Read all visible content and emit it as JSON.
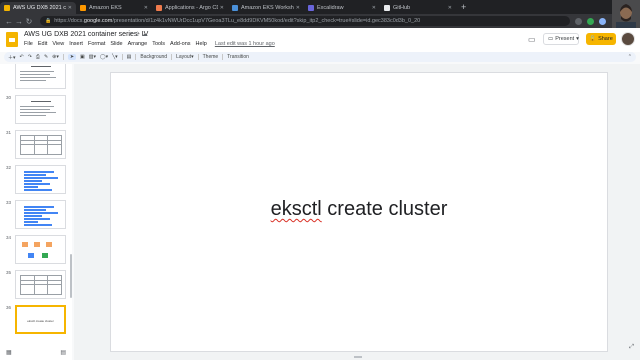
{
  "browser": {
    "tabs": [
      {
        "label": "AWS UG DXB 2021 conta",
        "active": true,
        "icon": "slides-favicon-icon",
        "color": "#f4b400"
      },
      {
        "label": "Amazon EKS",
        "active": false,
        "icon": "aws-favicon-icon",
        "color": "#ff9900"
      },
      {
        "label": "Applications - Argo CD",
        "active": false,
        "icon": "argo-favicon-icon",
        "color": "#ef7b4d"
      },
      {
        "label": "Amazon EKS Workshop",
        "active": false,
        "icon": "eks-favicon-icon",
        "color": "#4a90d9"
      },
      {
        "label": "Excalidraw",
        "active": false,
        "icon": "excalidraw-favicon-icon",
        "color": "#6965db"
      },
      {
        "label": "GitHub",
        "active": false,
        "icon": "github-favicon-icon",
        "color": "#e8eaed"
      }
    ],
    "new_tab": "+",
    "url_prefix": "https://docs.",
    "url_host": "google.com",
    "url_rest": "/presentation/d/1z4k1vNWUrDcc1upV7Geoa3TLu_e8dd9DKVM50kod/edit?skip_itp2_check=true#slide=id.gec383c0d3b_0_20",
    "back": "←",
    "forward": "→",
    "reload": "↻"
  },
  "docs": {
    "title": "AWS UG DXB 2021 container series- IV",
    "title_icons": "☆ ⇪ ☁",
    "menu": [
      "File",
      "Edit",
      "View",
      "Insert",
      "Format",
      "Slide",
      "Arrange",
      "Tools",
      "Add-ons",
      "Help"
    ],
    "last_edit": "Last edit was 1 hour ago",
    "present_label": "Present",
    "share_label": "Share",
    "toolbar": {
      "background": "Background",
      "layout": "Layout",
      "theme": "Theme",
      "transition": "Transition"
    }
  },
  "filmstrip": {
    "slides": [
      {
        "num": "29",
        "kind": "text"
      },
      {
        "num": "30",
        "kind": "text"
      },
      {
        "num": "31",
        "kind": "table"
      },
      {
        "num": "32",
        "kind": "bars"
      },
      {
        "num": "33",
        "kind": "bars"
      },
      {
        "num": "34",
        "kind": "diagram"
      },
      {
        "num": "35",
        "kind": "table"
      },
      {
        "num": "36",
        "kind": "title",
        "text": "eksctl create cluster",
        "selected": true
      }
    ]
  },
  "slide": {
    "word_misspelled": "eksctl",
    "rest": " create cluster"
  },
  "colors": {
    "accent": "#f6b500",
    "selection": "#f6b500"
  }
}
